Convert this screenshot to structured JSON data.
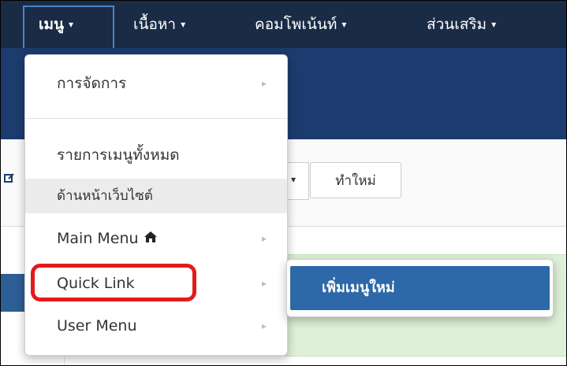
{
  "topnav": {
    "items": [
      {
        "label": "เมนู",
        "active": true
      },
      {
        "label": "เนื้อหา"
      },
      {
        "label": "คอมโพเน้นท์"
      },
      {
        "label": "ส่วนเสริม"
      }
    ],
    "caret": "▾"
  },
  "toolbar": {
    "dropdown_caret": "▾",
    "new_button_label": "ทำใหม่"
  },
  "menu_dropdown": {
    "items": [
      {
        "label": "การจัดการ",
        "has_submenu": true
      },
      {
        "label": "รายการเมนูทั้งหมด",
        "has_submenu": false
      },
      {
        "label": "ด้านหน้าเว็บไซต์",
        "has_submenu": false,
        "highlighted": true
      },
      {
        "label": "Main Menu",
        "has_submenu": true,
        "icon": "home-icon"
      },
      {
        "label": "Quick Link",
        "has_submenu": true,
        "callout": true
      },
      {
        "label": "User Menu",
        "has_submenu": true
      }
    ],
    "arrow_glyph": "▸"
  },
  "submenu": {
    "items": [
      {
        "label": "เพิ่มเมนูใหม่",
        "active": true
      }
    ]
  },
  "colors": {
    "topnav_bg": "#1a2b45",
    "subbar_bg": "#1c3b6e",
    "active_border": "#4a86c5",
    "submenu_active": "#2d68a8",
    "callout_red": "#e21b1b",
    "alert_green": "#dff0d8"
  }
}
